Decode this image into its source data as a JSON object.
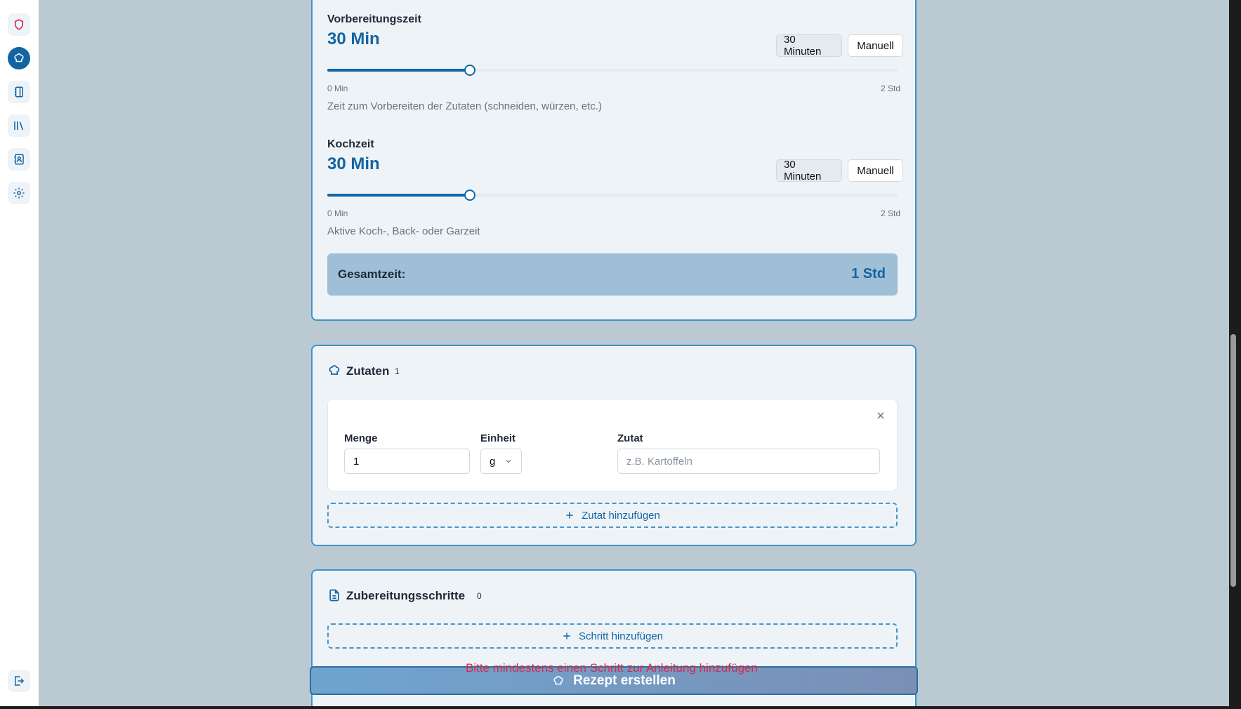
{
  "sidebar": {
    "items": [
      {
        "name": "shield",
        "icon": "shield-icon"
      },
      {
        "name": "recipes",
        "icon": "chef-hat-icon"
      },
      {
        "name": "notebook",
        "icon": "notebook-icon"
      },
      {
        "name": "library",
        "icon": "library-icon"
      },
      {
        "name": "contacts",
        "icon": "contact-book-icon"
      },
      {
        "name": "settings",
        "icon": "gear-icon"
      }
    ],
    "logout_icon": "logout-icon"
  },
  "times": {
    "prep": {
      "label": "Vorbereitungszeit",
      "value": "30 Min",
      "preset": "30 Minuten",
      "manual": "Manuell",
      "min_label": "0 Min",
      "max_label": "2 Std",
      "fraction": 0.25,
      "help": "Zeit zum Vorbereiten der Zutaten (schneiden, würzen, etc.)"
    },
    "cook": {
      "label": "Kochzeit",
      "value": "30 Min",
      "preset": "30 Minuten",
      "manual": "Manuell",
      "min_label": "0 Min",
      "max_label": "2 Std",
      "fraction": 0.25,
      "help": "Aktive Koch-, Back- oder Garzeit"
    },
    "total_label": "Gesamtzeit:",
    "total_value": "1 Std"
  },
  "ingredients": {
    "title": "Zutaten",
    "count": "1",
    "quantity_label": "Menge",
    "quantity_value": "1",
    "unit_label": "Einheit",
    "unit_value": "g",
    "ingredient_label": "Zutat",
    "ingredient_placeholder": "z.B. Kartoffeln",
    "add_label": "Zutat hinzufügen"
  },
  "steps": {
    "title": "Zubereitungsschritte",
    "count": "0",
    "add_label": "Schritt hinzufügen",
    "error": "Bitte mindestens einen Schritt zur Anleitung hinzufügen"
  },
  "submit": {
    "label": "Rezept erstellen"
  },
  "colors": {
    "accent": "#1264a3",
    "error": "#d62a4a",
    "background": "#bac9d2"
  }
}
